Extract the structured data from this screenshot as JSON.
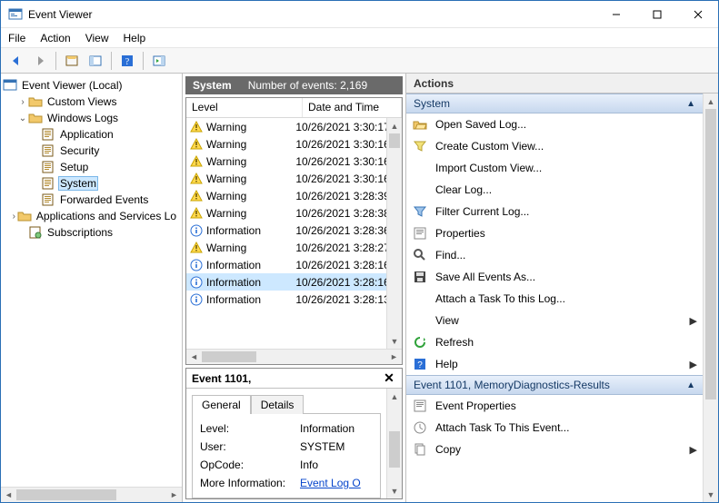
{
  "window": {
    "title": "Event Viewer"
  },
  "menubar": [
    "File",
    "Action",
    "View",
    "Help"
  ],
  "tree": {
    "root": "Event Viewer (Local)",
    "items": [
      {
        "label": "Custom Views",
        "expander": "›",
        "depth": 1,
        "icon": "folder"
      },
      {
        "label": "Windows Logs",
        "expander": "⌄",
        "depth": 1,
        "icon": "folder"
      },
      {
        "label": "Application",
        "expander": "",
        "depth": 2,
        "icon": "log"
      },
      {
        "label": "Security",
        "expander": "",
        "depth": 2,
        "icon": "log"
      },
      {
        "label": "Setup",
        "expander": "",
        "depth": 2,
        "icon": "log"
      },
      {
        "label": "System",
        "expander": "",
        "depth": 2,
        "icon": "log",
        "selected": true
      },
      {
        "label": "Forwarded Events",
        "expander": "",
        "depth": 2,
        "icon": "log"
      },
      {
        "label": "Applications and Services Logs",
        "expander": "›",
        "depth": 1,
        "icon": "folder",
        "truncated": "Applications and Services Lo"
      },
      {
        "label": "Subscriptions",
        "expander": "",
        "depth": 1,
        "icon": "subs"
      }
    ]
  },
  "events": {
    "panel_title": "System",
    "count_label": "Number of events: 2,169",
    "columns": [
      "Level",
      "Date and Time"
    ],
    "rows": [
      {
        "level": "Warning",
        "dt": "10/26/2021 3:30:17"
      },
      {
        "level": "Warning",
        "dt": "10/26/2021 3:30:16"
      },
      {
        "level": "Warning",
        "dt": "10/26/2021 3:30:16"
      },
      {
        "level": "Warning",
        "dt": "10/26/2021 3:30:16"
      },
      {
        "level": "Warning",
        "dt": "10/26/2021 3:28:39"
      },
      {
        "level": "Warning",
        "dt": "10/26/2021 3:28:38"
      },
      {
        "level": "Information",
        "dt": "10/26/2021 3:28:36"
      },
      {
        "level": "Warning",
        "dt": "10/26/2021 3:28:27"
      },
      {
        "level": "Information",
        "dt": "10/26/2021 3:28:16"
      },
      {
        "level": "Information",
        "dt": "10/26/2021 3:28:16",
        "selected": true
      },
      {
        "level": "Information",
        "dt": "10/26/2021 3:28:13"
      }
    ]
  },
  "detail": {
    "title": "Event 1101,",
    "tabs": [
      "General",
      "Details"
    ],
    "fields": [
      {
        "k": "Level:",
        "v": "Information"
      },
      {
        "k": "User:",
        "v": "SYSTEM"
      },
      {
        "k": "OpCode:",
        "v": "Info"
      }
    ],
    "more_info_label": "More Information:",
    "more_info_link": "Event Log O"
  },
  "actions": {
    "header": "Actions",
    "group1_title": "System",
    "group1": [
      {
        "icon": "open",
        "label": "Open Saved Log..."
      },
      {
        "icon": "funnelY",
        "label": "Create Custom View..."
      },
      {
        "icon": "blank",
        "label": "Import Custom View..."
      },
      {
        "icon": "blank",
        "label": "Clear Log..."
      },
      {
        "icon": "funnelB",
        "label": "Filter Current Log..."
      },
      {
        "icon": "props",
        "label": "Properties"
      },
      {
        "icon": "find",
        "label": "Find..."
      },
      {
        "icon": "save",
        "label": "Save All Events As..."
      },
      {
        "icon": "blank",
        "label": "Attach a Task To this Log..."
      },
      {
        "icon": "blank",
        "label": "View",
        "has_arrow": true
      },
      {
        "icon": "refresh",
        "label": "Refresh"
      },
      {
        "icon": "help",
        "label": "Help",
        "has_arrow": true
      }
    ],
    "group2_title": "Event 1101, MemoryDiagnostics-Results",
    "group2": [
      {
        "icon": "props",
        "label": "Event Properties"
      },
      {
        "icon": "task",
        "label": "Attach Task To This Event..."
      },
      {
        "icon": "copy",
        "label": "Copy",
        "has_arrow": true
      }
    ]
  }
}
